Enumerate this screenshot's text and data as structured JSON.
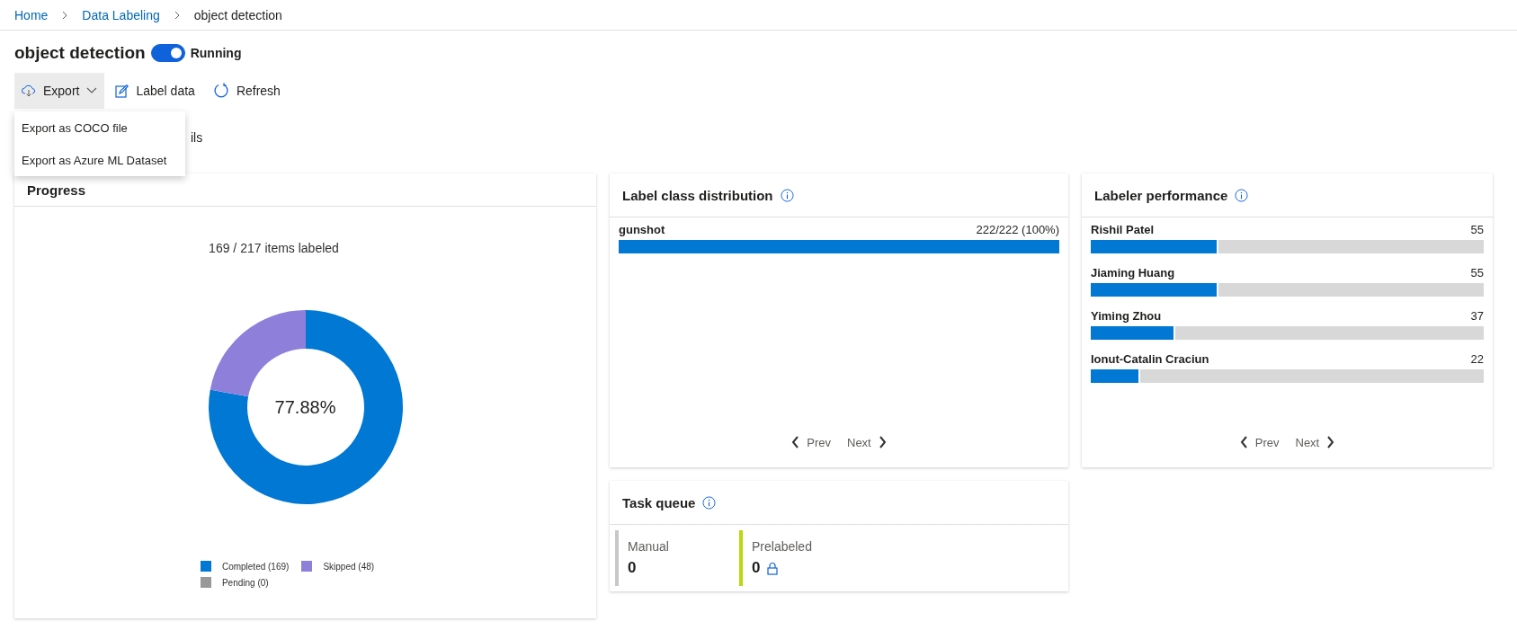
{
  "breadcrumb": [
    {
      "label": "Home",
      "link": true
    },
    {
      "label": "Data Labeling",
      "link": true
    },
    {
      "label": "object detection",
      "link": false
    }
  ],
  "title": "object detection",
  "status_toggle": {
    "on": true,
    "label": "Running"
  },
  "toolbar": [
    {
      "kind": "export",
      "label": "Export",
      "expanded": true
    },
    {
      "kind": "edit",
      "label": "Label data"
    },
    {
      "kind": "refresh",
      "label": "Refresh"
    }
  ],
  "export_menu": [
    "Export as COCO file",
    "Export as Azure ML Dataset"
  ],
  "tab_fragment": "ils",
  "progress": {
    "title": "Progress",
    "summary": "169 / 217 items labeled",
    "center_label": "77.88%",
    "chart_data": {
      "type": "donut",
      "values": [
        77.88,
        22.12,
        0
      ]
    },
    "legend": [
      {
        "label": "Completed (169)",
        "color": "#0078d4"
      },
      {
        "label": "Skipped (48)",
        "color": "#8e7fdb"
      },
      {
        "label": "Pending (0)",
        "color": "#999999"
      }
    ]
  },
  "label_class_distribution": {
    "title": "Label class distribution",
    "rows": [
      {
        "name": "gunshot",
        "reading": "222/222 (100%)",
        "level": 1
      }
    ],
    "pager": {
      "prev": "Prev",
      "next": "Next"
    }
  },
  "labeler_performance": {
    "title": "Labeler performance",
    "rows": [
      {
        "name": "Rishil Patel",
        "reading": "55",
        "level": 0.325
      },
      {
        "name": "Jiaming Huang",
        "reading": "55",
        "level": 0.325
      },
      {
        "name": "Yiming Zhou",
        "reading": "37",
        "level": 0.215
      },
      {
        "name": "Ionut-Catalin Craciun",
        "reading": "22",
        "level": 0.126
      }
    ],
    "pager": {
      "prev": "Prev",
      "next": "Next"
    }
  },
  "task_queue": {
    "title": "Task queue",
    "items": [
      {
        "label": "Manual",
        "count": "0",
        "color": "#c8c8c8",
        "locked": false
      },
      {
        "label": "Prelabeled",
        "count": "0",
        "color": "#bad80a",
        "locked": true
      }
    ]
  }
}
